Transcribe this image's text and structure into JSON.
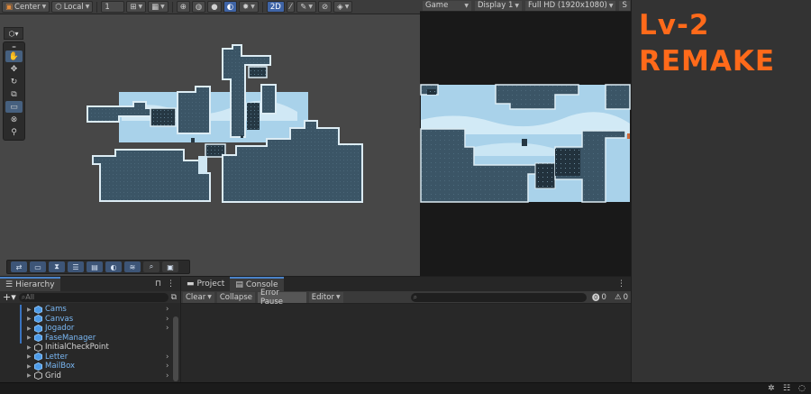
{
  "scene_toolbar": {
    "pivot": "Center",
    "space": "Local",
    "grid_value": "1",
    "mode_2d": "2D"
  },
  "tool_palette": {
    "tools": [
      "hand-tool",
      "move-tool",
      "rotate-tool",
      "scale-tool",
      "rect-tool",
      "transform-tool",
      "custom-tool"
    ]
  },
  "game_toolbar": {
    "tab_label": "Game",
    "display": "Display 1",
    "resolution": "Full HD (1920x1080)",
    "extra": "S"
  },
  "annotation": {
    "line1": "Lv-2",
    "line2": "REMAKE"
  },
  "hierarchy": {
    "tab_label": "Hierarchy",
    "search_placeholder": "All",
    "items": [
      {
        "name": "Cams",
        "blue": true,
        "expandable": true
      },
      {
        "name": "Canvas",
        "blue": true,
        "expandable": true
      },
      {
        "name": "Jogador",
        "blue": true,
        "expandable": true
      },
      {
        "name": "FaseManager",
        "blue": true,
        "expandable": false
      },
      {
        "name": "InitialCheckPoint",
        "blue": false,
        "expandable": false
      },
      {
        "name": "Letter",
        "blue": true,
        "expandable": true
      },
      {
        "name": "MailBox",
        "blue": true,
        "expandable": true
      },
      {
        "name": "Grid",
        "blue": false,
        "expandable": true
      }
    ]
  },
  "console": {
    "project_tab": "Project",
    "console_tab": "Console",
    "clear": "Clear",
    "collapse": "Collapse",
    "error_pause": "Error Pause",
    "editor": "Editor",
    "warn_count": "0",
    "error_count": "0"
  },
  "colors": {
    "accent": "#3f64a6",
    "annotation": "#ff6a1a",
    "tile_dark": "#3b5566",
    "tile_light": "#cfe6f2",
    "sky": "#a9d2ea"
  }
}
